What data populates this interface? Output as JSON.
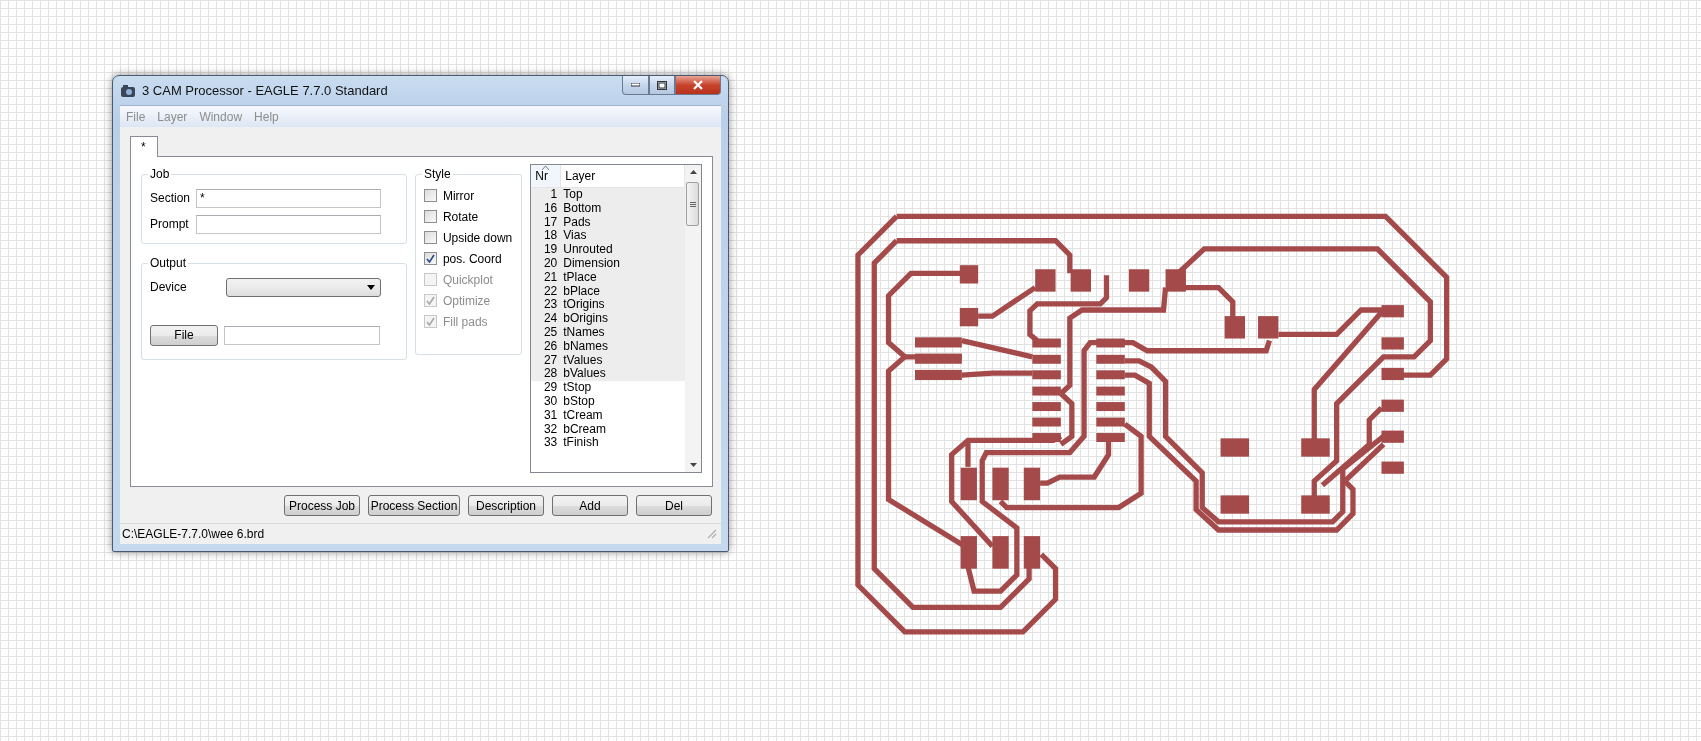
{
  "window": {
    "title": "3 CAM Processor - EAGLE 7.7.0 Standard"
  },
  "menu": [
    {
      "label": "File",
      "disabled": true
    },
    {
      "label": "Layer",
      "disabled": true
    },
    {
      "label": "Window",
      "disabled": true
    },
    {
      "label": "Help",
      "disabled": true
    }
  ],
  "tabs": [
    {
      "label": "*",
      "selected": true
    }
  ],
  "job": {
    "title": "Job",
    "fields": [
      {
        "label": "Section",
        "value": "*"
      },
      {
        "label": "Prompt"
      }
    ]
  },
  "output": {
    "title": "Output",
    "device_label": "Device",
    "file_button": "File"
  },
  "style": {
    "title": "Style",
    "options": [
      {
        "label": "Mirror",
        "checked": false,
        "disabled": false
      },
      {
        "label": "Rotate",
        "checked": false,
        "disabled": false
      },
      {
        "label": "Upside down",
        "checked": false,
        "disabled": false
      },
      {
        "label": "pos. Coord",
        "checked": true,
        "disabled": false
      },
      {
        "label": "Quickplot",
        "checked": false,
        "disabled": true
      },
      {
        "label": "Optimize",
        "checked": true,
        "disabled": true
      },
      {
        "label": "Fill pads",
        "checked": true,
        "disabled": true
      }
    ]
  },
  "layers": {
    "columns": [
      "Nr",
      "Layer"
    ],
    "rows": [
      {
        "nr": "1",
        "name": "Top",
        "selected": true
      },
      {
        "nr": "16",
        "name": "Bottom",
        "selected": true
      },
      {
        "nr": "17",
        "name": "Pads",
        "selected": true
      },
      {
        "nr": "18",
        "name": "Vias",
        "selected": true
      },
      {
        "nr": "19",
        "name": "Unrouted",
        "selected": true
      },
      {
        "nr": "20",
        "name": "Dimension",
        "selected": true
      },
      {
        "nr": "21",
        "name": "tPlace",
        "selected": true
      },
      {
        "nr": "22",
        "name": "bPlace",
        "selected": true
      },
      {
        "nr": "23",
        "name": "tOrigins",
        "selected": true
      },
      {
        "nr": "24",
        "name": "bOrigins",
        "selected": true
      },
      {
        "nr": "25",
        "name": "tNames",
        "selected": true
      },
      {
        "nr": "26",
        "name": "bNames",
        "selected": true
      },
      {
        "nr": "27",
        "name": "tValues",
        "selected": true
      },
      {
        "nr": "28",
        "name": "bValues",
        "selected": true
      },
      {
        "nr": "29",
        "name": "tStop",
        "selected": false
      },
      {
        "nr": "30",
        "name": "bStop",
        "selected": false
      },
      {
        "nr": "31",
        "name": "tCream",
        "selected": false
      },
      {
        "nr": "32",
        "name": "bCream",
        "selected": false
      },
      {
        "nr": "33",
        "name": "tFinish",
        "selected": false
      }
    ]
  },
  "buttons": [
    "Process Job",
    "Process Section",
    "Description",
    "Add",
    "Del"
  ],
  "status_bar": "C:\\EAGLE-7.7.0\\wee 6.brd"
}
